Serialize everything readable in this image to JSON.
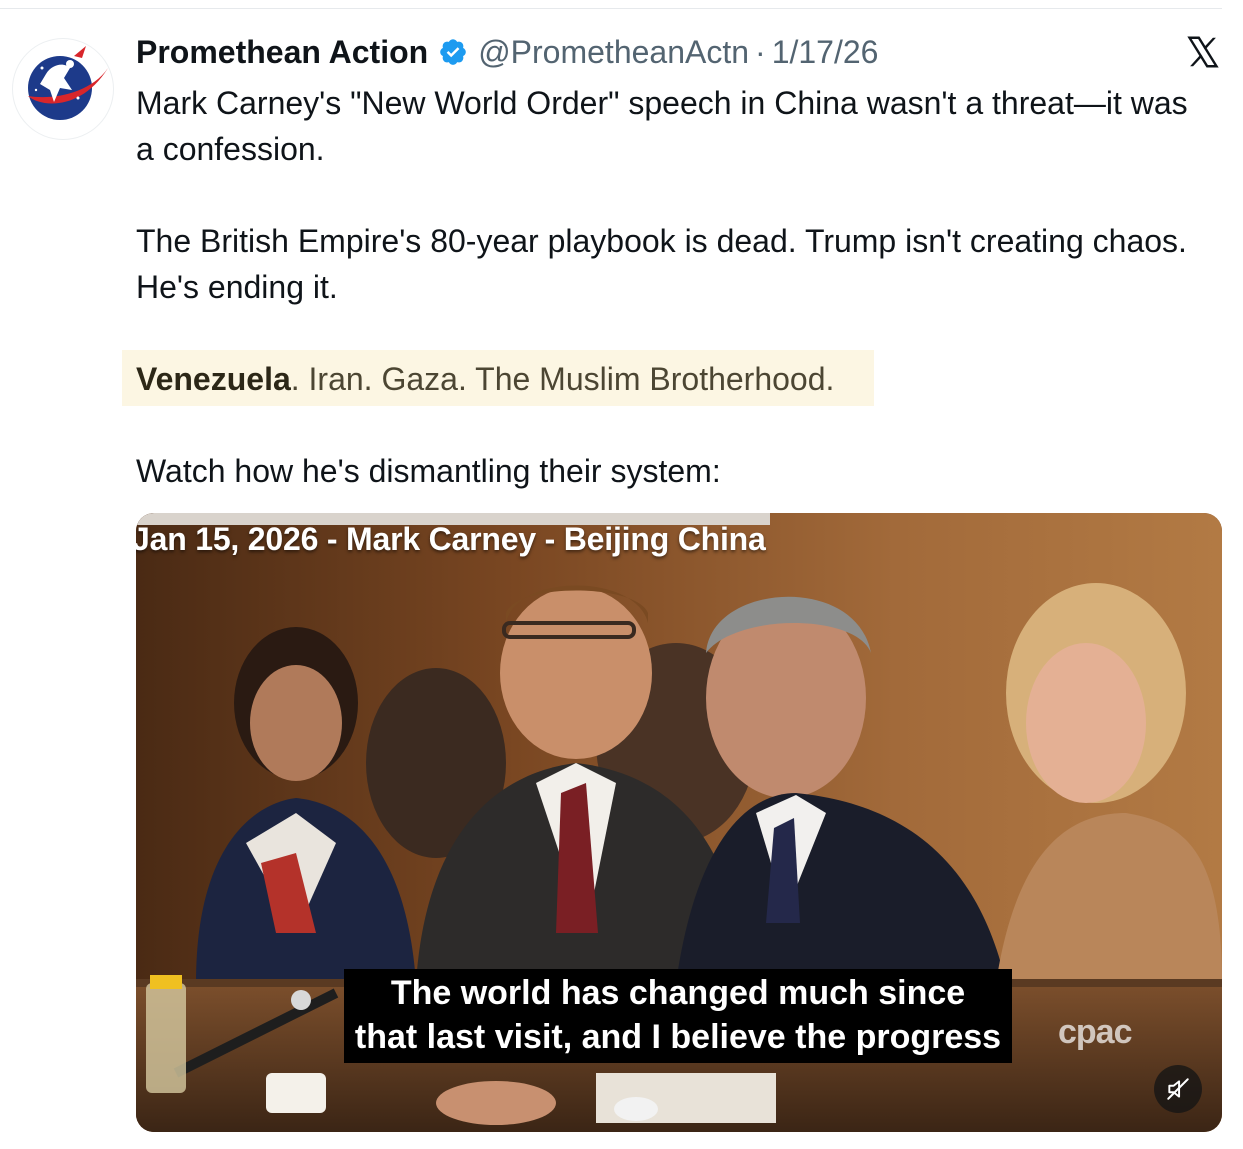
{
  "tweet": {
    "display_name": "Promethean Action",
    "handle": "@PrometheanActn",
    "separator": "·",
    "date": "1/17/26",
    "paragraphs": [
      "Mark Carney's \"New World Order\" speech in China wasn't a threat—it was a confession.",
      "The British Empire's 80-year playbook is dead. Trump isn't creating chaos. He's ending it."
    ],
    "highlight": {
      "bold": "Venezuela",
      "rest": ". Iran. Gaza. The Muslim Brotherhood."
    },
    "closing": "Watch how he's dismantling their system:"
  },
  "video": {
    "title_overlay": "Jan 15, 2026 - Mark Carney - Beijing China",
    "subtitle_lines": [
      "The world has changed much since",
      "that last visit, and I believe the progress"
    ],
    "watermark": "cpac"
  },
  "icons": {
    "avatar": "promethean-logo-avatar",
    "verified": "verified-badge-icon",
    "platform": "x-logo-icon",
    "mute": "speaker-muted-icon"
  },
  "colors": {
    "text": "#0f1419",
    "secondary": "#536471",
    "verified": "#1d9bf0",
    "highlight": "#fcf6e3",
    "avatar_blue": "#1d3a8a",
    "avatar_red": "#d8262b"
  }
}
